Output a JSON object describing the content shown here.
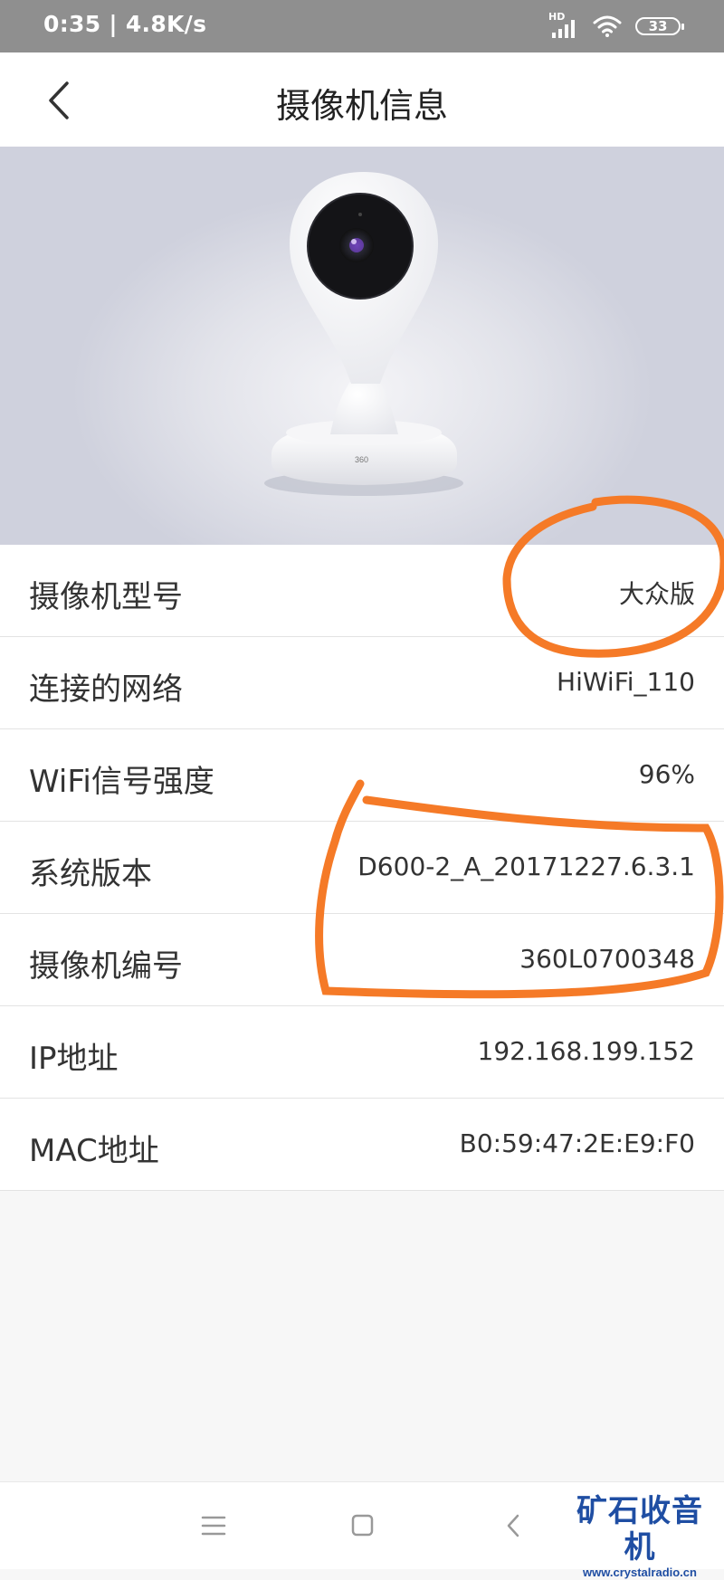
{
  "status_bar": {
    "time_speed": "0:35 | 4.8K/s",
    "network_badge": "HD",
    "battery": "33",
    "icons": [
      "signal-icon",
      "wifi-icon",
      "battery-icon"
    ]
  },
  "header": {
    "title": "摄像机信息",
    "back_icon": "chevron-left-icon"
  },
  "hero": {
    "brand_mark": "360"
  },
  "info_rows": [
    {
      "label": "摄像机型号",
      "value": "大众版"
    },
    {
      "label": "连接的网络",
      "value": "HiWiFi_110"
    },
    {
      "label": "WiFi信号强度",
      "value": "96%"
    },
    {
      "label": "系统版本",
      "value": "D600-2_A_20171227.6.3.1"
    },
    {
      "label": "摄像机编号",
      "value": "360L0700348"
    },
    {
      "label": "IP地址",
      "value": "192.168.199.152"
    },
    {
      "label": "MAC地址",
      "value": "B0:59:47:2E:E9:F0"
    }
  ],
  "navigation_bar": {
    "icons": [
      "menu-icon",
      "home-icon",
      "back-icon"
    ]
  },
  "watermark": {
    "title": "矿石收音机",
    "url": "www.crystalradio.cn"
  },
  "colors": {
    "annotation": "#f57a27",
    "watermark": "#1f4ea3",
    "status_bar": "#8f8f8f"
  }
}
